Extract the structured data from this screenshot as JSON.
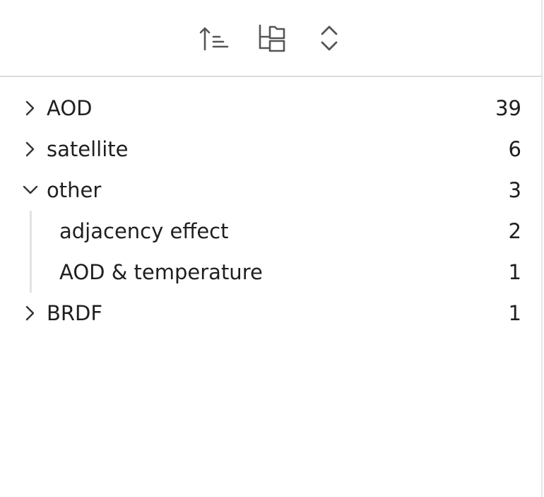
{
  "toolbar": {
    "buttons": [
      {
        "name": "sort-icon",
        "icon": "sort-ascending"
      },
      {
        "name": "folder-tree-icon",
        "icon": "folder-tree"
      },
      {
        "name": "expand-collapse-icon",
        "icon": "chevron-up-down"
      }
    ]
  },
  "tree": {
    "items": [
      {
        "label": "AOD",
        "count": "39",
        "expanded": false
      },
      {
        "label": "satellite",
        "count": "6",
        "expanded": false
      },
      {
        "label": "other",
        "count": "3",
        "expanded": true,
        "children": [
          {
            "label": "adjacency effect",
            "count": "2"
          },
          {
            "label": "AOD & temperature",
            "count": "1"
          }
        ]
      },
      {
        "label": "BRDF",
        "count": "1",
        "expanded": false
      }
    ]
  },
  "colors": {
    "text": "#1f1f1f",
    "icon": "#555555",
    "divider": "#dcdcdc",
    "guide": "#e3e3e3"
  }
}
